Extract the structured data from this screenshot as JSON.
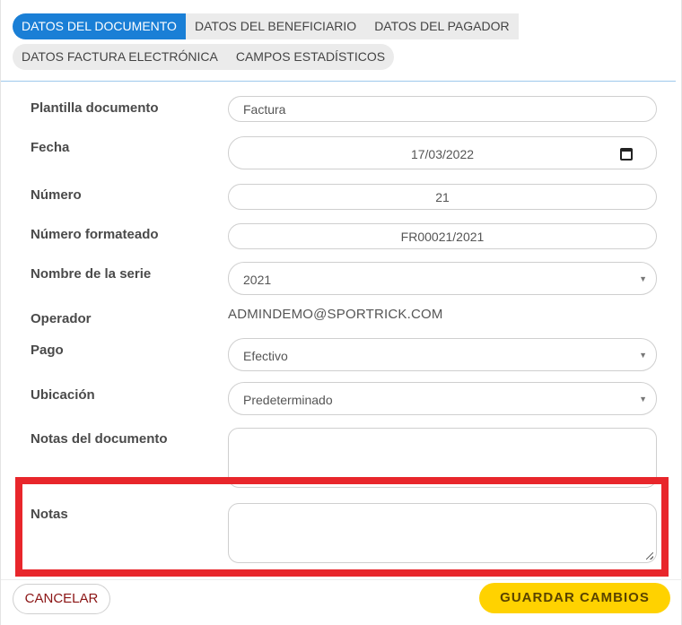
{
  "tabs": {
    "row1": [
      "DATOS DEL DOCUMENTO",
      "DATOS DEL BENEFICIARIO",
      "DATOS DEL PAGADOR"
    ],
    "row2": [
      "DATOS FACTURA ELECTRÓNICA",
      "CAMPOS ESTADÍSTICOS"
    ],
    "active": "DATOS DEL DOCUMENTO"
  },
  "form": {
    "plantilla": {
      "label": "Plantilla documento",
      "value": "Factura"
    },
    "fecha": {
      "label": "Fecha",
      "value": "17/03/2022"
    },
    "numero": {
      "label": "Número",
      "value": "21"
    },
    "numero_formateado": {
      "label": "Número formateado",
      "value": "FR00021/2021"
    },
    "serie": {
      "label": "Nombre de la serie",
      "value": "2021"
    },
    "operador": {
      "label": "Operador",
      "value": "ADMINDEMO@SPORTRICK.COM"
    },
    "pago": {
      "label": "Pago",
      "value": "Efectivo"
    },
    "ubicacion": {
      "label": "Ubicación",
      "value": "Predeterminado"
    },
    "notas_documento": {
      "label": "Notas del documento",
      "value": ""
    },
    "notas": {
      "label": "Notas",
      "value": ""
    }
  },
  "actions": {
    "cancel": "CANCELAR",
    "save": "GUARDAR CAMBIOS"
  },
  "colors": {
    "active_tab": "#1a7fd6",
    "save_button": "#ffd200",
    "highlight": "#e8262b"
  }
}
